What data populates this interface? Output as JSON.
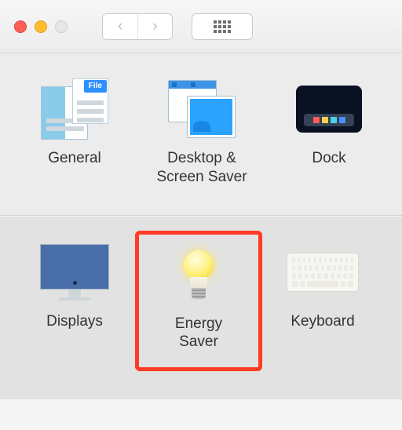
{
  "titlebar": {
    "back": "‹",
    "forward": "›"
  },
  "row1": [
    {
      "id": "general",
      "label": "General"
    },
    {
      "id": "desktop-screen-saver",
      "label": "Desktop &\nScreen Saver"
    },
    {
      "id": "dock",
      "label": "Dock"
    }
  ],
  "row2": [
    {
      "id": "displays",
      "label": "Displays"
    },
    {
      "id": "energy-saver",
      "label": "Energy\nSaver",
      "highlighted": true
    },
    {
      "id": "keyboard",
      "label": "Keyboard"
    }
  ],
  "general_file_tag": "File"
}
